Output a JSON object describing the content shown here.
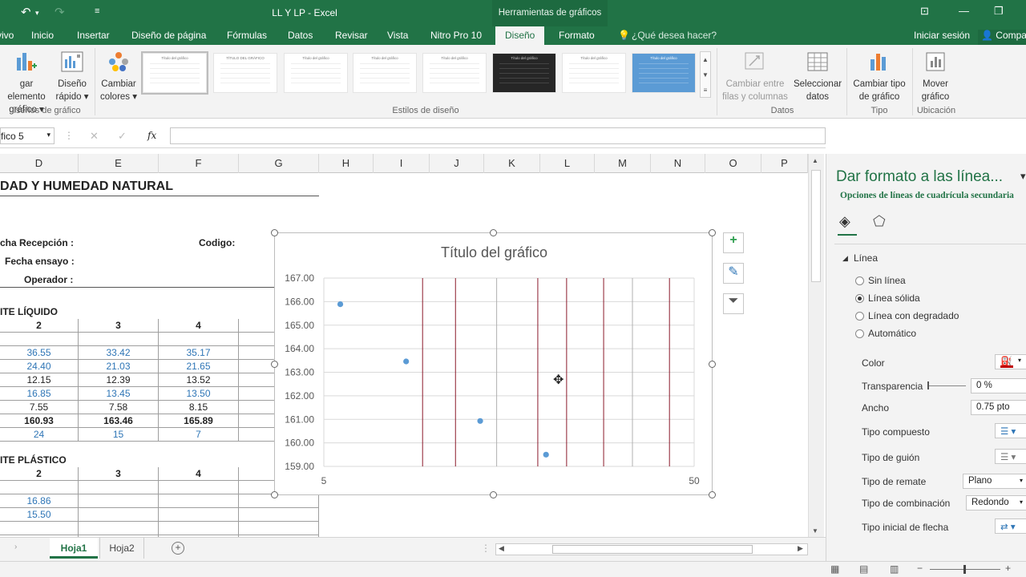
{
  "window": {
    "title": "LL Y LP - Excel",
    "context_tools": "Herramientas de gráficos",
    "undo_icon": "undo-icon",
    "redo_icon": "redo-icon"
  },
  "tabs": [
    "vivo",
    "Inicio",
    "Insertar",
    "Diseño de página",
    "Fórmulas",
    "Datos",
    "Revisar",
    "Vista",
    "Nitro Pro 10",
    "Diseño",
    "Formato"
  ],
  "active_tab": "Diseño",
  "tell_me": "¿Qué desea hacer?",
  "signin": "Iniciar sesión",
  "share": "Compa",
  "ribbon": {
    "add_element_1": "gar elemento",
    "add_element_2": "gráfico ▾",
    "quick_layout_1": "Diseño",
    "quick_layout_2": "rápido ▾",
    "change_colors_1": "Cambiar",
    "change_colors_2": "colores ▾",
    "group_layouts": "iseños de gráfico",
    "group_styles": "Estilos de diseño",
    "switch_1": "Cambiar entre",
    "switch_2": "filas y columnas",
    "select_1": "Seleccionar",
    "select_2": "datos",
    "group_data": "Datos",
    "change_type_1": "Cambiar tipo",
    "change_type_2": "de gráfico",
    "group_type": "Tipo",
    "move_1": "Mover",
    "move_2": "gráfico",
    "group_location": "Ubicación",
    "style_titles": [
      "Título del gráfico",
      "TÍTULO DEL GRÁFICO",
      "Título del gráfico",
      "Título del gráfico",
      "Título del gráfico",
      "Título del gráfico",
      "Título del gráfico",
      "Título del gráfico"
    ]
  },
  "formula_bar": {
    "name_box": "fico 5",
    "cancel": "✕",
    "enter": "✓",
    "fx": "fx"
  },
  "columns": [
    "D",
    "E",
    "F",
    "G",
    "H",
    "I",
    "J",
    "K",
    "L",
    "M",
    "N",
    "O",
    "P"
  ],
  "sheet": {
    "heading": "DAD Y HUMEDAD NATURAL",
    "reception": "cha Recepción :",
    "code": "Codigo:",
    "test_date": "Fecha ensayo :",
    "operator": "Operador :",
    "section_liquid": "ITE LÍQUIDO",
    "liquid_headers": [
      "2",
      "3",
      "4"
    ],
    "liquid_rows": [
      [
        "36.55",
        "33.42",
        "35.17"
      ],
      [
        "24.40",
        "21.03",
        "21.65"
      ],
      [
        "12.15",
        "12.39",
        "13.52"
      ],
      [
        "16.85",
        "13.45",
        "13.50"
      ],
      [
        "7.55",
        "7.58",
        "8.15"
      ],
      [
        "160.93",
        "163.46",
        "165.89"
      ],
      [
        "24",
        "15",
        "7"
      ]
    ],
    "section_plastic": "ITE PLÁSTICO",
    "plastic_headers": [
      "2",
      "3",
      "4"
    ],
    "plastic_rows": [
      [
        "16.86"
      ],
      [
        "15.50"
      ]
    ]
  },
  "sheet_tabs": [
    "Hoja1",
    "Hoja2"
  ],
  "active_sheet": "Hoja1",
  "chart_data": {
    "type": "scatter",
    "title": "Título del gráfico",
    "xlim": [
      5,
      50
    ],
    "ylim": [
      159.0,
      167.0
    ],
    "x_tick_labels": [
      "5",
      "50"
    ],
    "y_tick_labels": [
      "167.00",
      "166.00",
      "165.00",
      "164.00",
      "163.00",
      "162.00",
      "161.00",
      "160.00",
      "159.00"
    ],
    "series": [
      {
        "x": [
          7,
          15,
          24,
          32
        ],
        "y": [
          165.89,
          163.46,
          160.93,
          159.5
        ],
        "color": "#5b9bd5"
      }
    ],
    "minor_vertical_gridlines_x": [
      17,
      21,
      26,
      31,
      34.5,
      39,
      42.5,
      47
    ],
    "minor_vertical_gridline_colors": [
      "#8b1a2b",
      "#8b1a2b",
      "#b0b0b0",
      "#8b1a2b",
      "#8b1a2b",
      "#8b1a2b",
      "#b0b0b0",
      "#8b1a2b"
    ]
  },
  "pane": {
    "title": "Dar formato a las línea...",
    "subtitle": "Opciones de líneas de cuadrícula secundaria",
    "section": "Línea",
    "options": [
      "Sin línea",
      "Línea sólida",
      "Línea con degradado",
      "Automático"
    ],
    "selected_option": 1,
    "color_label": "Color",
    "transparency_label": "Transparencia",
    "transparency_value": "0 %",
    "width_label": "Ancho",
    "width_value": "0.75 pto",
    "compound_label": "Tipo compuesto",
    "dash_label": "Tipo de guión",
    "cap_label": "Tipo de remate",
    "cap_value": "Plano",
    "join_label": "Tipo de combinación",
    "join_value": "Redondo",
    "arrow_label": "Tipo inicial de flecha",
    "line_color": "#c00000"
  }
}
